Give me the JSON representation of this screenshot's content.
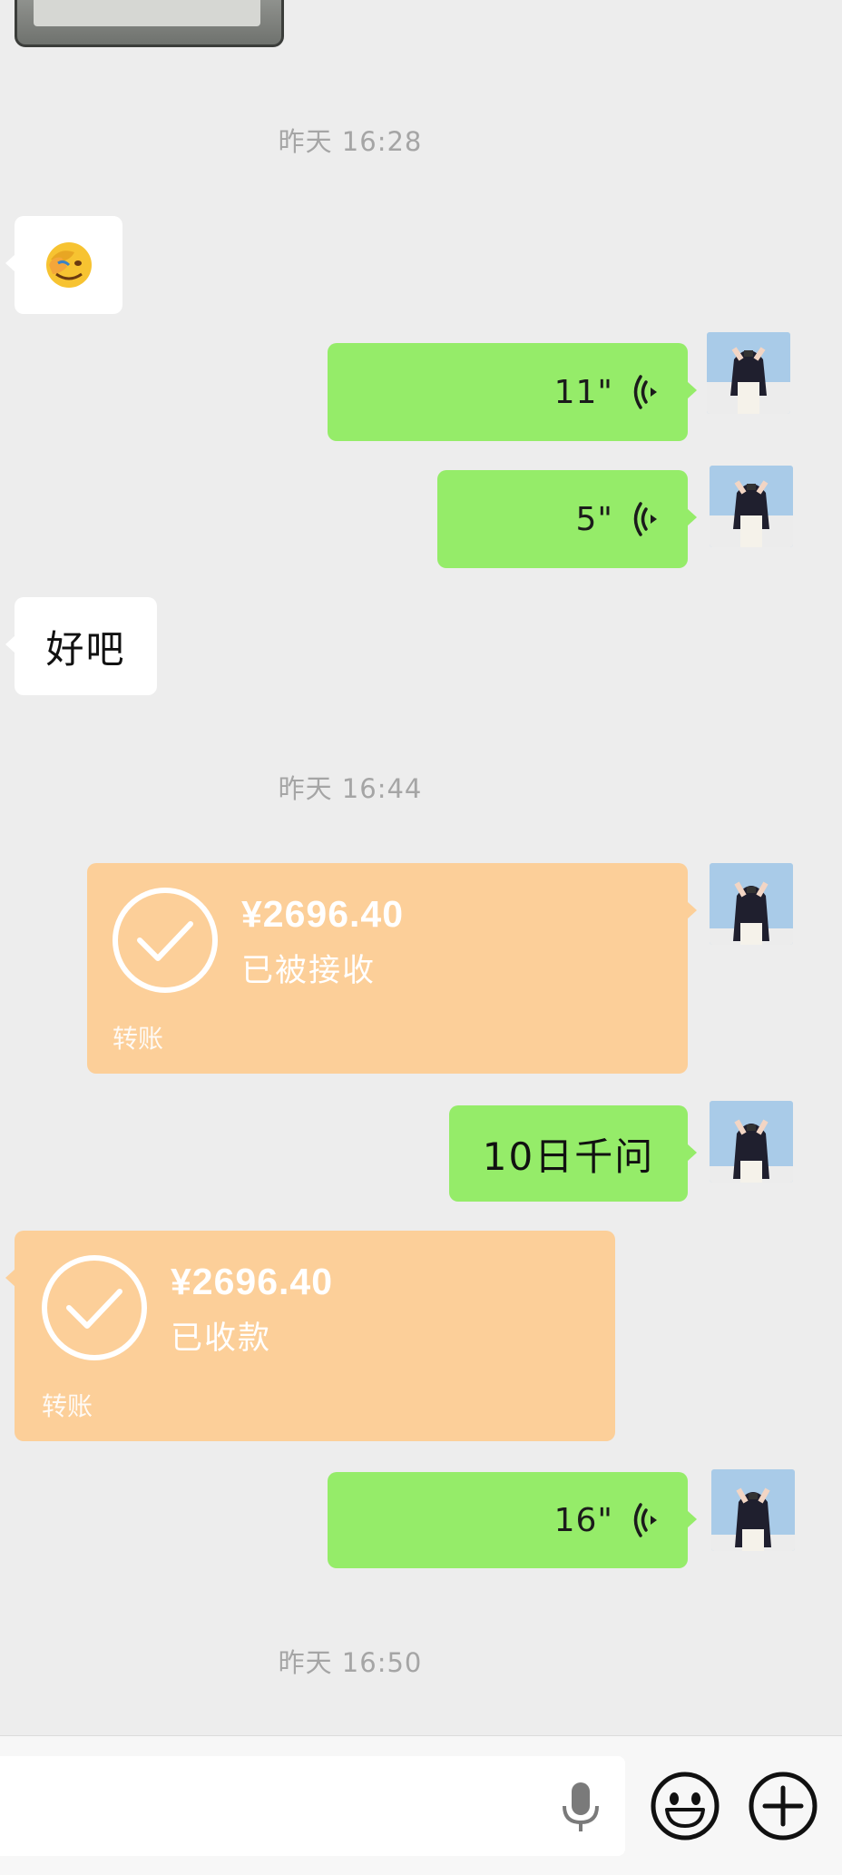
{
  "chat": {
    "timestamps": [
      "昨天 16:28",
      "昨天 16:44",
      "昨天 16:50"
    ],
    "messages": {
      "emoji_reply": {
        "sender": "other",
        "type": "emoji",
        "icon": "facepalm-emoji-icon"
      },
      "voice_1": {
        "sender": "me",
        "type": "voice",
        "duration": "11\""
      },
      "voice_2": {
        "sender": "me",
        "type": "voice",
        "duration": "5\""
      },
      "text_ok": {
        "sender": "other",
        "type": "text",
        "text": "好吧"
      },
      "transfer_sent": {
        "sender": "me",
        "type": "transfer",
        "amount": "¥2696.40",
        "status": "已被接收",
        "label": "转账"
      },
      "text_question": {
        "sender": "me",
        "type": "text",
        "text": "10日千问"
      },
      "transfer_received": {
        "sender": "other",
        "type": "transfer",
        "amount": "¥2696.40",
        "status": "已收款",
        "label": "转账"
      },
      "voice_3": {
        "sender": "me",
        "type": "voice",
        "duration": "16\""
      }
    }
  },
  "input_bar": {
    "icons": [
      "microphone-icon",
      "emoji-icon",
      "plus-icon"
    ]
  },
  "colors": {
    "background": "#ededed",
    "my_bubble": "#95ec69",
    "other_bubble": "#ffffff",
    "transfer_card": "#fccf99",
    "timestamp_text": "#a5a5a5"
  }
}
